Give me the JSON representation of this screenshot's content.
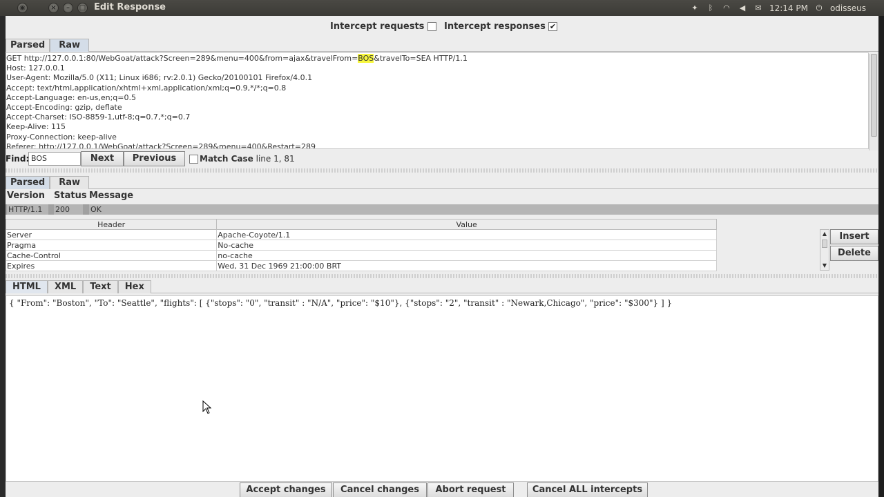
{
  "window": {
    "title": "Edit Response",
    "tray_time": "12:14 PM",
    "tray_user": "odisseus"
  },
  "intercept": {
    "requests_label": "Intercept requests :",
    "requests_checked": false,
    "responses_label": "Intercept responses :",
    "responses_checked": true
  },
  "request_tabs": [
    "Parsed",
    "Raw"
  ],
  "request_lines": [
    "GET http://127.0.0.1:80/WebGoat/attack?Screen=289&menu=400&from=ajax&travelFrom=",
    "Host: 127.0.0.1",
    "User-Agent: Mozilla/5.0 (X11; Linux i686; rv:2.0.1) Gecko/20100101 Firefox/4.0.1",
    "Accept: text/html,application/xhtml+xml,application/xml;q=0.9,*/*;q=0.8",
    "Accept-Language: en-us,en;q=0.5",
    "Accept-Encoding: gzip, deflate",
    "Accept-Charset: ISO-8859-1,utf-8;q=0.7,*;q=0.7",
    "Keep-Alive: 115",
    "Proxy-Connection: keep-alive",
    "Referer: http://127.0.0.1/WebGoat/attack?Screen=289&menu=400&Restart=289"
  ],
  "request_highlight": "BOS",
  "request_line1_tail": "&travelTo=SEA HTTP/1.1",
  "find": {
    "label": "Find:",
    "value": "BOS",
    "next": "Next",
    "previous": "Previous",
    "match_case": "Match Case",
    "position": "line 1, 81"
  },
  "response_tabs": [
    "Parsed",
    "Raw"
  ],
  "status_line": {
    "headers": [
      "Version",
      "Status",
      "Message"
    ],
    "version": "HTTP/1.1",
    "status": "200",
    "message": "OK"
  },
  "header_table": {
    "columns": [
      "Header",
      "Value"
    ],
    "rows": [
      [
        "Server",
        "Apache-Coyote/1.1"
      ],
      [
        "Pragma",
        "No-cache"
      ],
      [
        "Cache-Control",
        "no-cache"
      ],
      [
        "Expires",
        "Wed, 31 Dec 1969 21:00:00 BRT"
      ]
    ],
    "insert": "Insert",
    "delete": "Delete"
  },
  "body_tabs": [
    "HTML",
    "XML",
    "Text",
    "Hex"
  ],
  "body_text": "{ \"From\": \"Boston\", \"To\": \"Seattle\", \"flights\": [ {\"stops\": \"0\", \"transit\" : \"N/A\", \"price\": \"$10\"}, {\"stops\": \"2\", \"transit\" : \"Newark,Chicago\", \"price\": \"$300\"} ] }",
  "bottom_buttons": {
    "accept": "Accept changes",
    "cancel": "Cancel changes",
    "abort": "Abort request",
    "cancel_all": "Cancel ALL intercepts"
  }
}
